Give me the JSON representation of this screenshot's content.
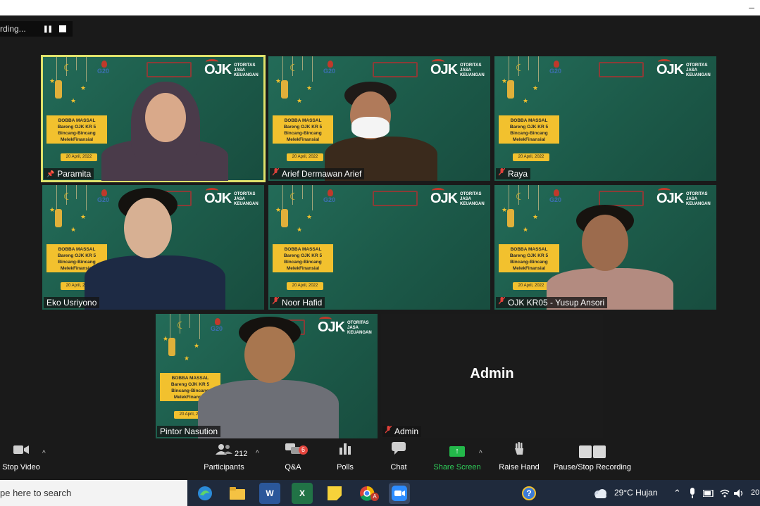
{
  "window": {
    "minimize_glyph": "–"
  },
  "recording": {
    "status_text": "rding...",
    "pause_glyph": "❚❚",
    "stop_glyph": "■"
  },
  "brand": {
    "ojk_mark": "OJK",
    "ojk_words": [
      "OTORITAS",
      "JASA",
      "KEUANGAN"
    ],
    "g20": "G20",
    "banner_lines": [
      "BOBBA MASSAL",
      "Bareng OJK KR 5",
      "Bincang-Bincang",
      "MelekFinansial"
    ],
    "date": "20 April, 2022"
  },
  "participants": [
    {
      "name": "Paramita",
      "muted": false,
      "pinned": true,
      "active": true
    },
    {
      "name": "Arief Dermawan Arief",
      "muted": true,
      "pinned": false,
      "active": false
    },
    {
      "name": "Raya",
      "muted": true,
      "pinned": false,
      "active": false
    },
    {
      "name": "Eko Usriyono",
      "muted": false,
      "pinned": false,
      "active": false
    },
    {
      "name": "Noor Hafid",
      "muted": true,
      "pinned": false,
      "active": false
    },
    {
      "name": "OJK KR05 - Yusup Ansori",
      "muted": true,
      "pinned": false,
      "active": false
    },
    {
      "name": "Pintor Nasution",
      "muted": false,
      "pinned": false,
      "active": false
    },
    {
      "name": "Admin",
      "muted": true,
      "pinned": false,
      "active": false,
      "video_off_label": "Admin"
    }
  ],
  "toolbar": {
    "stop_video": "Stop Video",
    "participants": "Participants",
    "participants_count": "212",
    "qa": "Q&A",
    "qa_badge": "6",
    "polls": "Polls",
    "chat": "Chat",
    "share_screen": "Share Screen",
    "raise_hand": "Raise Hand",
    "pause_stop_recording": "Pause/Stop Recording",
    "caret": "^"
  },
  "taskbar": {
    "search_placeholder": "pe here to search",
    "apps": [
      "Edge",
      "File Explorer",
      "Word",
      "Excel",
      "Sticky Notes",
      "Chrome",
      "Zoom"
    ],
    "app_letters": {
      "word": "W",
      "excel": "X",
      "chrome": "A"
    },
    "help_glyph": "?",
    "weather": "29°C  Hujan",
    "clock_fragment": "20"
  },
  "colors": {
    "tile_green": "#1f6150",
    "active_border": "#dfe26b",
    "share_green": "#23b84a",
    "muted_red": "#e0413a",
    "banner_yellow": "#f2c12e"
  }
}
